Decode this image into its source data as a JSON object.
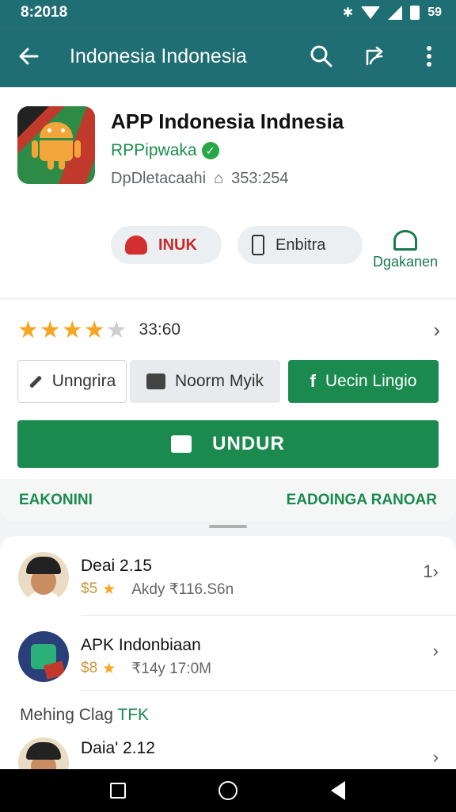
{
  "status_bar": {
    "time": "8:2018",
    "battery": "59"
  },
  "app_bar": {
    "title": "Indonesia Indonesia"
  },
  "app": {
    "name": "APP Indonesia Indnesia",
    "developer": "RPPipwaka",
    "meta_left": "DpDletacaahi",
    "meta_right": "353:254"
  },
  "chips": {
    "red": "INUK",
    "gray": "Enbitra",
    "side": "Dgakanen"
  },
  "rating": {
    "stars": 4,
    "max": 5,
    "value": "33:60"
  },
  "actions": {
    "outline": "Unngrira",
    "gray": "Noorm Myik",
    "green": "Uecin Lingio"
  },
  "download": {
    "label": "UNDUR"
  },
  "tabs": {
    "left": "EAKONINI",
    "right": "EADOINGA RANOAR"
  },
  "list": [
    {
      "name": "Deai 2.15",
      "price": "$5",
      "detail": "Akdy ₹116.S6n",
      "trail": "1"
    },
    {
      "name": "APK Indonbiaan",
      "price": "$8",
      "detail": "₹14y 17:0M",
      "trail": ""
    },
    {
      "name": "Daia' 2.12",
      "price": "",
      "detail": "",
      "trail": ""
    }
  ],
  "section": {
    "title": "Mehing Clag",
    "accent": "TFK"
  },
  "colors": {
    "primary": "#1f6e73",
    "green": "#1b8a4f",
    "star": "#f5a623"
  }
}
